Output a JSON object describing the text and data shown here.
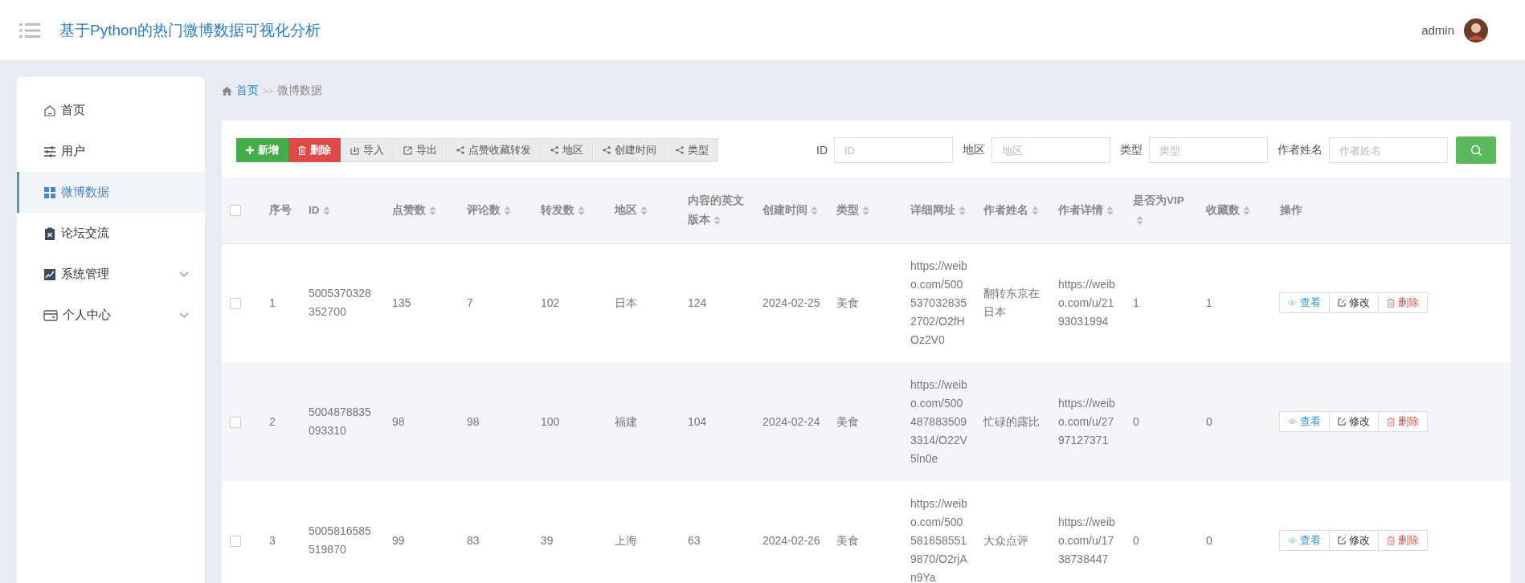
{
  "header": {
    "title": "基于Python的热门微博数据可视化分析",
    "user": "admin"
  },
  "sidebar": {
    "items": [
      {
        "label": "首页",
        "kind": "home",
        "selected": false
      },
      {
        "label": "用户",
        "kind": "sliders",
        "selected": false
      },
      {
        "label": "微博数据",
        "kind": "grid",
        "selected": true
      },
      {
        "label": "论坛交流",
        "kind": "clipboard",
        "selected": false
      },
      {
        "label": "系统管理",
        "kind": "chart",
        "selected": false,
        "expanded": false
      },
      {
        "label": "个人中心",
        "kind": "card",
        "selected": false,
        "expanded": false
      }
    ]
  },
  "breadcrumb": {
    "home": "首页",
    "separator": ">>",
    "current": "微博数据"
  },
  "toolbar": [
    {
      "label": "新增",
      "kind": "add"
    },
    {
      "label": "删除",
      "kind": "delete"
    },
    {
      "label": "导入",
      "kind": "import"
    },
    {
      "label": "导出",
      "kind": "export"
    },
    {
      "label": "点赞收藏转发",
      "kind": "chart"
    },
    {
      "label": "地区",
      "kind": "chart"
    },
    {
      "label": "创建时间",
      "kind": "chart"
    },
    {
      "label": "类型",
      "kind": "chart"
    }
  ],
  "search": {
    "fields": [
      {
        "label": "ID",
        "placeholder": "ID"
      },
      {
        "label": "地区",
        "placeholder": "地区"
      },
      {
        "label": "类型",
        "placeholder": "类型"
      },
      {
        "label": "作者姓名",
        "placeholder": "作者姓名"
      }
    ]
  },
  "table": {
    "all_checked": false,
    "columns": [
      {
        "label": "序号",
        "sortable": false
      },
      {
        "label": "ID",
        "sortable": true
      },
      {
        "label": "点赞数",
        "sortable": true
      },
      {
        "label": "评论数",
        "sortable": true
      },
      {
        "label": "转发数",
        "sortable": true
      },
      {
        "label": "地区",
        "sortable": true
      },
      {
        "label": "内容的英文版本",
        "sortable": true
      },
      {
        "label": "创建时间",
        "sortable": true
      },
      {
        "label": "类型",
        "sortable": true
      },
      {
        "label": "详细网址",
        "sortable": true
      },
      {
        "label": "作者姓名",
        "sortable": true
      },
      {
        "label": "作者详情",
        "sortable": true
      },
      {
        "label": "是否为VIP",
        "sortable": true
      },
      {
        "label": "收藏数",
        "sortable": true
      },
      {
        "label": "操作",
        "sortable": false
      }
    ],
    "rows": [
      {
        "checked": false,
        "cells": [
          "1",
          "5005370328352700",
          "135",
          "7",
          "102",
          "日本",
          "124",
          "2024-02-25",
          "美食",
          "https://weibo.com/5005370328352702/O2fHOz2V0",
          "翻转东京在日本",
          "https://weibo.com/u/2193031994",
          "1",
          "1"
        ],
        "actions": [
          {
            "label": "查看",
            "kind": "view"
          },
          {
            "label": "修改",
            "kind": "edit"
          },
          {
            "label": "删除",
            "kind": "delete"
          }
        ]
      },
      {
        "checked": false,
        "cells": [
          "2",
          "5004878835093310",
          "98",
          "98",
          "100",
          "福建",
          "104",
          "2024-02-24",
          "美食",
          "https://weibo.com/5004878835093314/O22V5ln0e",
          "忙碌的露比",
          "https://weibo.com/u/2797127371",
          "0",
          "0"
        ],
        "actions": [
          {
            "label": "查看",
            "kind": "view"
          },
          {
            "label": "修改",
            "kind": "edit"
          },
          {
            "label": "删除",
            "kind": "delete"
          }
        ]
      },
      {
        "checked": false,
        "cells": [
          "3",
          "5005816585519870",
          "99",
          "83",
          "39",
          "上海",
          "63",
          "2024-02-26",
          "美食",
          "https://weibo.com/5005816585519870/O2rjAn9Ya",
          "大众点评",
          "https://weibo.com/u/1738738447",
          "0",
          "0"
        ],
        "actions": [
          {
            "label": "查看",
            "kind": "view"
          },
          {
            "label": "修改",
            "kind": "edit"
          },
          {
            "label": "删除",
            "kind": "delete"
          }
        ]
      }
    ]
  }
}
